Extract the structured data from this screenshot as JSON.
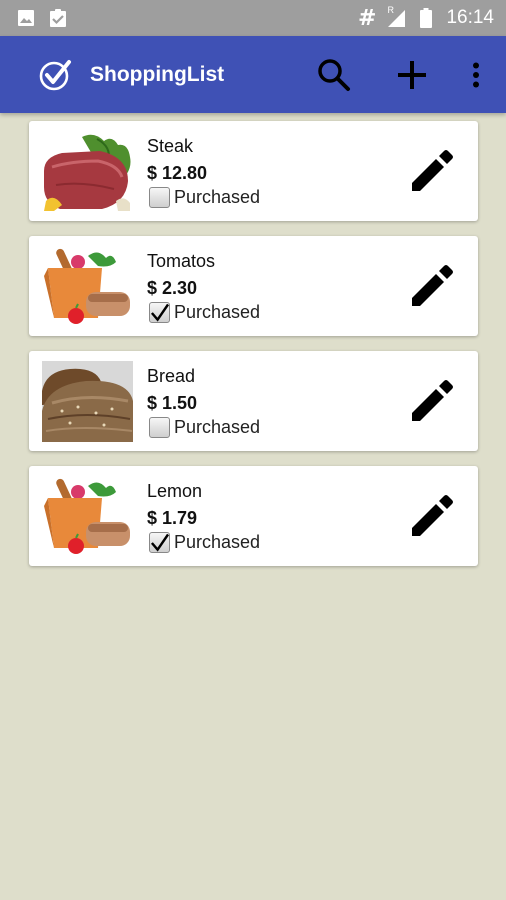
{
  "status_bar": {
    "icons": [
      "image-icon",
      "clipboard-check-icon",
      "hash-icon",
      "signal-icon",
      "battery-icon"
    ],
    "hash_text": "#",
    "roaming_text": "R",
    "time": "16:14"
  },
  "app_bar": {
    "title": "ShoppingList",
    "color": "#3f51b5",
    "actions": [
      "search-icon",
      "add-icon",
      "more-vert-icon"
    ]
  },
  "items": [
    {
      "name": "Steak",
      "price": "$ 12.80",
      "purchased_label": "Purchased",
      "purchased": false,
      "image": "steak-photo"
    },
    {
      "name": "Tomatos",
      "price": "$ 2.30",
      "purchased_label": "Purchased",
      "purchased": true,
      "image": "grocery-bag-icon"
    },
    {
      "name": "Bread",
      "price": "$ 1.50",
      "purchased_label": "Purchased",
      "purchased": false,
      "image": "bread-photo"
    },
    {
      "name": "Lemon",
      "price": "$ 1.79",
      "purchased_label": "Purchased",
      "purchased": true,
      "image": "grocery-bag-icon"
    }
  ],
  "colors": {
    "background": "#dedecb",
    "card": "#ffffff",
    "status_bar": "#9e9e9e"
  }
}
